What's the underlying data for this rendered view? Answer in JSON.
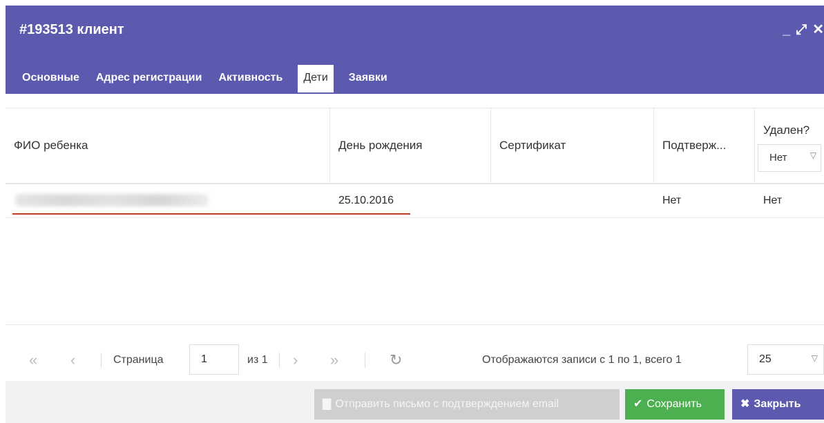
{
  "window": {
    "title": "#193513 клиент",
    "controls": {
      "minimize": "_",
      "maximize": "⤢",
      "close": "✕"
    }
  },
  "tabs": [
    {
      "label": "Основные",
      "active": false
    },
    {
      "label": "Адрес регистрации",
      "active": false
    },
    {
      "label": "Активность",
      "active": false
    },
    {
      "label": "Дети",
      "active": true
    },
    {
      "label": "Заявки",
      "active": false
    }
  ],
  "grid": {
    "columns": [
      "ФИО ребенка",
      "День рождения",
      "Сертификат",
      "Подтверж...",
      "Удален?"
    ],
    "filter": {
      "value": "Нет",
      "arrow": "▽"
    },
    "rows": [
      {
        "name": "",
        "birthday": "25.10.2016",
        "certificate": "",
        "confirmed": "Нет",
        "deleted": "Нет"
      }
    ]
  },
  "pager": {
    "first": "«",
    "prev": "‹",
    "page_label": "Страница",
    "page_value": "1",
    "of_label": "из 1",
    "next": "›",
    "last": "»",
    "refresh": "↻",
    "info": "Отображаются записи с 1 по 1, всего 1",
    "page_size": "25",
    "page_size_arrow": "▽"
  },
  "footer": {
    "send_email_label": "Отправить письмо с подтверждением email",
    "send_email_icon": "trash-icon",
    "save_label": "Сохранить",
    "save_icon": "✔",
    "close_label": "Закрыть",
    "close_icon": "✖"
  },
  "colors": {
    "header": "#5b5aae",
    "save": "#4caf50",
    "close": "#5b5aae",
    "disabled": "#cfcfcf",
    "underline": "#c0392b"
  }
}
